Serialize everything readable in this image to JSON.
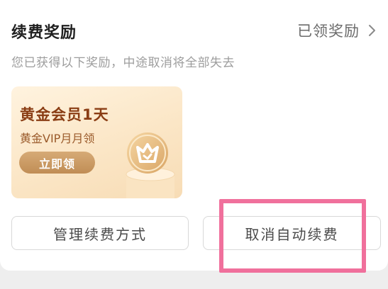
{
  "section": {
    "title": "续费奖励",
    "claimed_rewards_link": "已领奖励",
    "subtitle": "您已获得以下奖励，中途取消将全部失去"
  },
  "reward": {
    "title": "黄金会员1天",
    "description": "黄金VIP月月领",
    "claim_label": "立即领",
    "icon": "vip-crown-badge-icon"
  },
  "actions": {
    "manage_label": "管理续费方式",
    "cancel_label": "取消自动续费"
  },
  "colors": {
    "highlight": "#f0709c",
    "reward_title": "#8a3d14",
    "claim_button": "#c9975f"
  }
}
